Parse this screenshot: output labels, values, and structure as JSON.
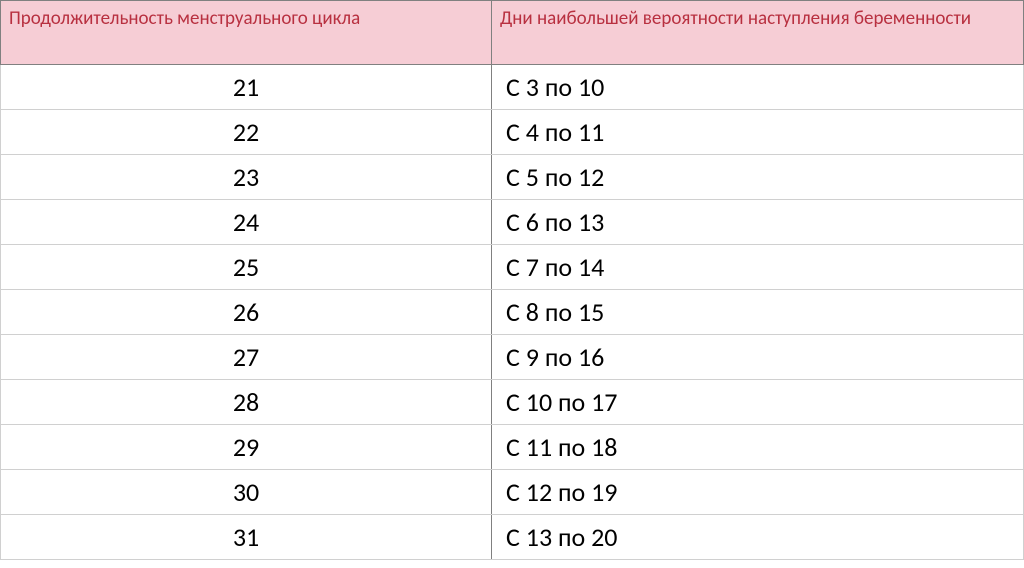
{
  "table": {
    "headers": {
      "col1": "Продолжительность менструального цикла",
      "col2": "Дни наибольшей вероятности наступления беременности"
    },
    "rows": [
      {
        "cycle": "21",
        "days": "С 3  по 10"
      },
      {
        "cycle": "22",
        "days": "С 4 по 11"
      },
      {
        "cycle": "23",
        "days": "С 5 по 12"
      },
      {
        "cycle": "24",
        "days": "С 6 по 13"
      },
      {
        "cycle": "25",
        "days": "С 7 по 14"
      },
      {
        "cycle": "26",
        "days": "С 8 по 15"
      },
      {
        "cycle": "27",
        "days": "С 9 по 16"
      },
      {
        "cycle": "28",
        "days": "С 10 по 17"
      },
      {
        "cycle": "29",
        "days": "С 11 по 18"
      },
      {
        "cycle": "30",
        "days": "С 12 по 19"
      },
      {
        "cycle": "31",
        "days": "С 13 по 20"
      }
    ]
  }
}
